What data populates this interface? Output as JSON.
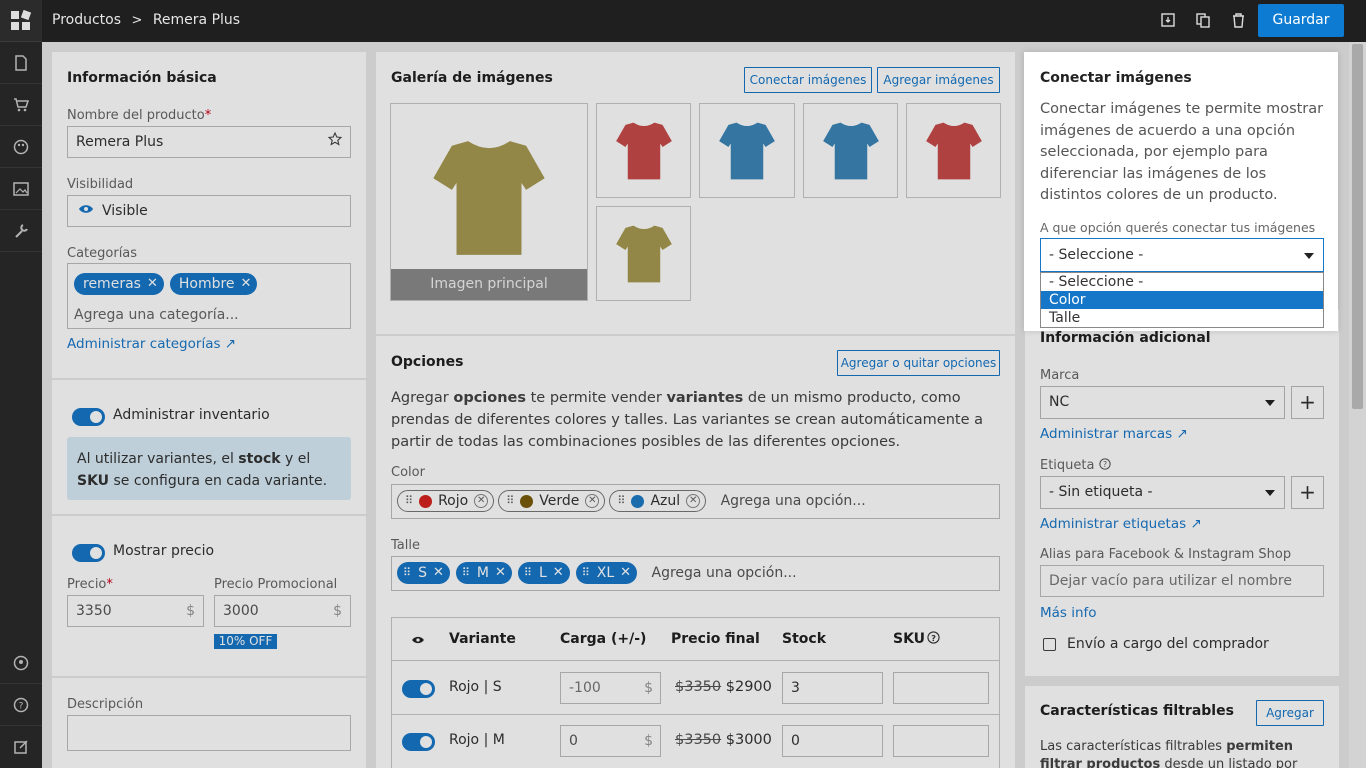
{
  "breadcrumb": {
    "parent": "Productos",
    "separator": ">",
    "current": "Remera Plus"
  },
  "toolbar": {
    "save_label": "Guardar"
  },
  "basic": {
    "title": "Información básica",
    "name_label": "Nombre del producto",
    "required_mark": "*",
    "name_value": "Remera Plus",
    "visibility_label": "Visibilidad",
    "visibility_value": "Visible",
    "categories_label": "Categorías",
    "categories": [
      "remeras",
      "Hombre"
    ],
    "category_placeholder": "Agrega una categoría...",
    "manage_categories": "Administrar categorías ↗"
  },
  "inventory": {
    "toggle_label": "Administrar inventario",
    "info_pre": "Al utilizar variantes, el ",
    "info_bold1": "stock",
    "info_mid": " y el ",
    "info_bold2": "SKU",
    "info_post": " se configura en cada variante."
  },
  "price": {
    "toggle_label": "Mostrar precio",
    "price_label": "Precio",
    "price_value": "3350",
    "promo_label": "Precio Promocional",
    "promo_value": "3000",
    "currency": "$",
    "discount_badge": "10% OFF"
  },
  "description": {
    "label": "Descripción"
  },
  "gallery": {
    "title": "Galería de imágenes",
    "connect_button": "Conectar imágenes",
    "add_button": "Agregar imágenes",
    "main_caption": "Imagen principal",
    "main_color": "#a89a52",
    "thumb_colors": [
      "#c94b4b",
      "#3d86b8",
      "#3d86b8",
      "#c94b4b",
      "#a89a52"
    ]
  },
  "options": {
    "title": "Opciones",
    "edit_button": "Agregar o quitar opciones",
    "desc_pre": "Agregar ",
    "desc_b1": "opciones",
    "desc_mid": " te permite vender ",
    "desc_b2": "variantes",
    "desc_post": " de un mismo producto, como prendas de diferentes colores y talles. Las variantes se crean automáticamente a partir de todas las combinaciones posibles de las diferentes opciones.",
    "color_label": "Color",
    "colors": [
      {
        "name": "Rojo",
        "swatch": "#d6231e"
      },
      {
        "name": "Verde",
        "swatch": "#7a5c0c"
      },
      {
        "name": "Azul",
        "swatch": "#1e7bc4"
      }
    ],
    "option_placeholder": "Agrega una opción...",
    "size_label": "Talle",
    "sizes": [
      "S",
      "M",
      "L",
      "XL"
    ]
  },
  "variants": {
    "headers": {
      "variant": "Variante",
      "load": "Carga (+/-)",
      "final": "Precio final",
      "stock": "Stock",
      "sku": "SKU"
    },
    "rows": [
      {
        "name": "Rojo | S",
        "load": "-100",
        "old_price": "$3350",
        "new_price": "$2900",
        "stock": "3"
      },
      {
        "name": "Rojo | M",
        "load": "0",
        "old_price": "$3350",
        "new_price": "$3000",
        "stock": "0"
      }
    ]
  },
  "connect_panel": {
    "title": "Conectar imágenes",
    "description": "Conectar imágenes te permite mostrar imágenes de acuerdo a una opción seleccionada, por ejemplo para diferenciar las imágenes de los distintos colores de un producto.",
    "select_label": "A que opción querés conectar tus imágenes",
    "selected": "- Seleccione -",
    "options": [
      "- Seleccione -",
      "Color",
      "Talle"
    ]
  },
  "additional": {
    "title": "Información adicional",
    "brand_label": "Marca",
    "brand_value": "NC",
    "manage_brands": "Administrar marcas ↗",
    "tag_label": "Etiqueta",
    "tag_value": "- Sin etiqueta -",
    "manage_tags": "Administrar etiquetas ↗",
    "alias_label": "Alias para Facebook & Instagram Shop",
    "alias_placeholder": "Dejar vacío para utilizar el nombre",
    "more_info": "Más info",
    "shipping_label": "Envío a cargo del comprador"
  },
  "filters": {
    "title": "Características filtrables",
    "add_button": "Agregar",
    "desc_pre": "Las características filtrables ",
    "desc_b": "permiten filtrar productos",
    "desc_post": " desde un listado por características"
  }
}
